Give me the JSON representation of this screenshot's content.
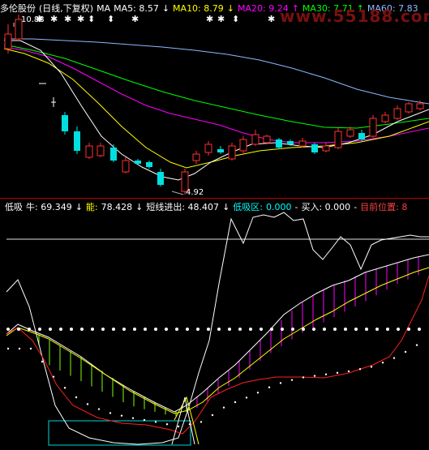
{
  "header": {
    "stock_name": "多伦股份",
    "period": "(日线,下复权)",
    "ma_label": "MA",
    "ma5": "MA5: 8.57",
    "ma10": "MA10: 8.79",
    "ma20": "MA20: 9.24",
    "ma30": "MA30: 7.71",
    "ma60": "MA60: 7.83",
    "arrow_down": "↓",
    "arrow_up": "↑",
    "high_label": "10.88",
    "low_label": "4.92",
    "watermark": "www.55188.com"
  },
  "indicator": {
    "name": "低吸",
    "niu": "牛: 69.349",
    "neng_label": "能:",
    "neng_value": "78.428",
    "short_line": "短线进出: 48.407",
    "dixi_zone_label": "低吸区:",
    "dixi_zone_value": "0.000",
    "buy": "买入: 0.000",
    "position": "目前位置: 8",
    "arrow_down": "↓",
    "dash": "-"
  },
  "colors": {
    "up_candle": "#ff3030",
    "down_candle": "#00e0e0",
    "ma5": "#ffffff",
    "ma10": "#ffff00",
    "ma20": "#ff00ff",
    "ma30": "#00ff00",
    "ma60": "#8fb8ff",
    "divider": "#c00000"
  }
}
